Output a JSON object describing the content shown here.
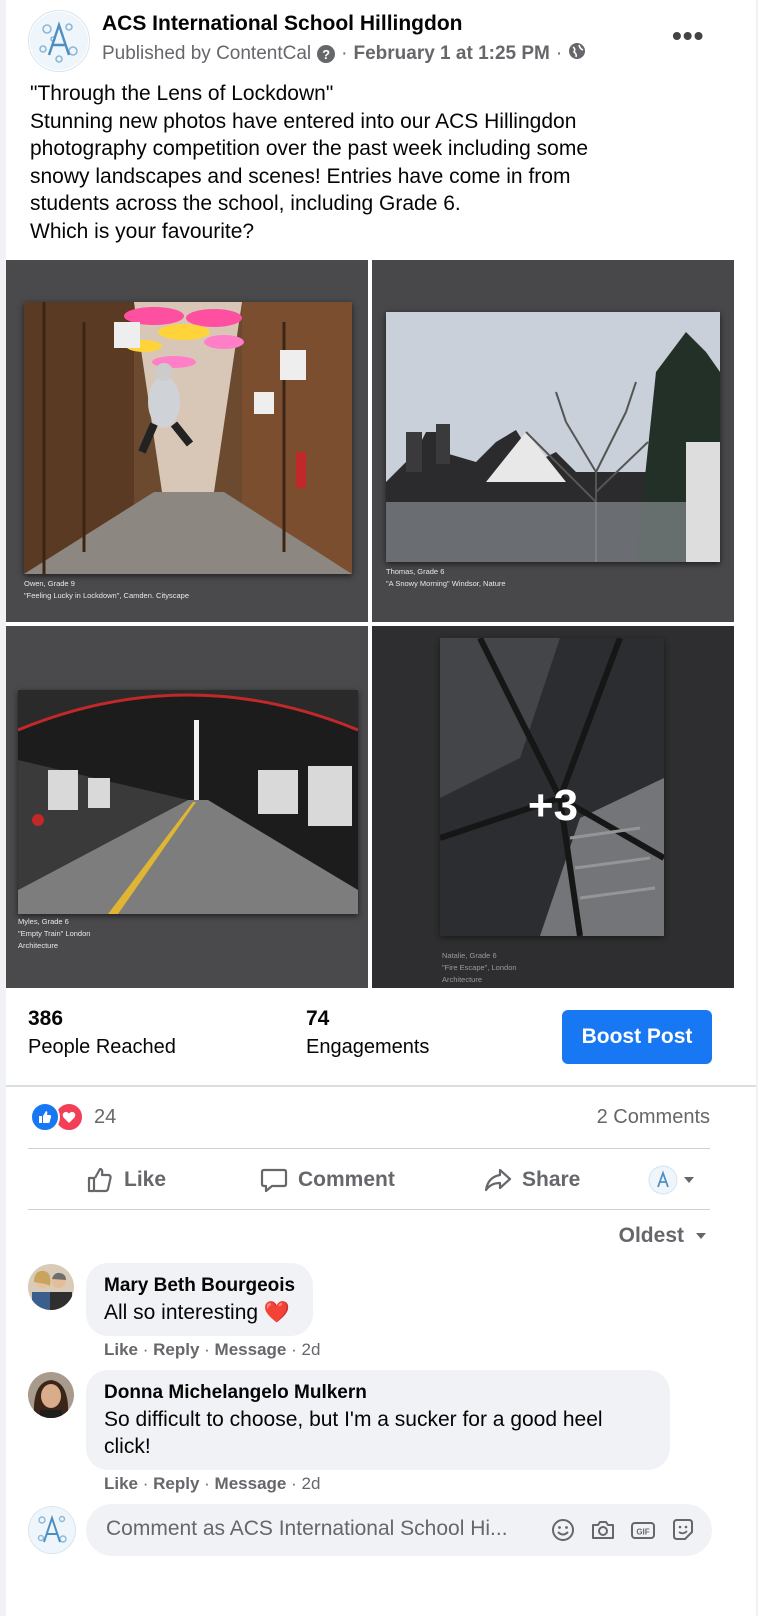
{
  "post": {
    "page_name": "ACS International School Hillingdon",
    "published_by": "Published by ContentCal",
    "help_mark": "?",
    "date": "February 1 at 1:25 PM",
    "separator": "·",
    "more_label": "•••",
    "text_lines": [
      "\"Through the Lens of Lockdown\"",
      "Stunning new photos have entered into our ACS Hillingdon",
      "photography competition over the past week including some",
      "snowy landscapes and scenes! Entries have come in from",
      "students across the school, including Grade 6.",
      "Which is your favourite?"
    ]
  },
  "photos": [
    {
      "caption_lines": [
        "Owen, Grade 9",
        "\"Feeling Lucky in Lockdown\", Camden. Cityscape"
      ]
    },
    {
      "caption_lines": [
        "Thomas, Grade 6",
        "\"A Snowy Morning\"  Windsor,  Nature"
      ]
    },
    {
      "caption_lines": [
        "Myles, Grade 6",
        "\"Empty Train\" London",
        "Architecture"
      ]
    },
    {
      "caption_lines": [
        "Natalie, Grade 6",
        "\"Fire Escape\", London",
        "Architecture"
      ],
      "overlay": "+3"
    }
  ],
  "insights": {
    "people_reached": {
      "value": "386",
      "label": "People Reached"
    },
    "engagements": {
      "value": "74",
      "label": "Engagements"
    },
    "boost_label": "Boost Post"
  },
  "reactions": {
    "count": "24",
    "comments_label": "2 Comments"
  },
  "actions": {
    "like": "Like",
    "comment": "Comment",
    "share": "Share"
  },
  "sort_label": "Oldest",
  "comments": [
    {
      "name": "Mary Beth Bourgeois",
      "text": "All so interesting",
      "emoji": "❤️",
      "actions": [
        "Like",
        "Reply",
        "Message"
      ],
      "age": "2d"
    },
    {
      "name": "Donna Michelangelo Mulkern",
      "text": "So difficult to choose, but I'm a sucker for a good heel click!",
      "actions": [
        "Like",
        "Reply",
        "Message"
      ],
      "age": "2d"
    }
  ],
  "composer": {
    "placeholder": "Comment as ACS International School Hi..."
  },
  "colors": {
    "accent": "#1877f2",
    "love": "#f33e58",
    "secondary_text": "#65676b"
  }
}
